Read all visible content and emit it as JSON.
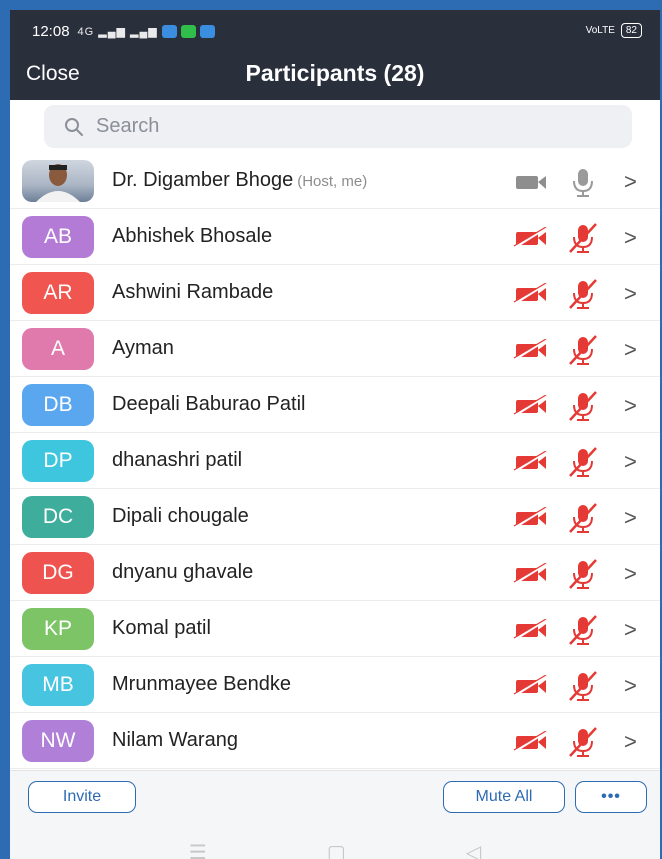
{
  "status_bar": {
    "time": "12:08",
    "signal_text": "4G",
    "network_label": "VoLTE",
    "battery": "82"
  },
  "header": {
    "close_label": "Close",
    "title": "Participants (28)"
  },
  "search": {
    "placeholder": "Search"
  },
  "participants": [
    {
      "initials": "",
      "name": "Dr. Digamber Bhoge",
      "role": "(Host, me)",
      "color": "#9aa6b5",
      "photo": true,
      "video": "on",
      "audio": "on"
    },
    {
      "initials": "AB",
      "name": "Abhishek Bhosale",
      "role": "",
      "color": "#b37ad6",
      "photo": false,
      "video": "off",
      "audio": "muted"
    },
    {
      "initials": "AR",
      "name": "Ashwini Rambade",
      "role": "",
      "color": "#f0564f",
      "photo": false,
      "video": "off",
      "audio": "muted"
    },
    {
      "initials": "A",
      "name": "Ayman",
      "role": "",
      "color": "#e07aac",
      "photo": false,
      "video": "off",
      "audio": "muted"
    },
    {
      "initials": "DB",
      "name": "Deepali Baburao Patil",
      "role": "",
      "color": "#5aa7f0",
      "photo": false,
      "video": "off",
      "audio": "muted"
    },
    {
      "initials": "DP",
      "name": "dhanashri patil",
      "role": "",
      "color": "#3ec6df",
      "photo": false,
      "video": "off",
      "audio": "muted"
    },
    {
      "initials": "DC",
      "name": "Dipali chougale",
      "role": "",
      "color": "#3fad9c",
      "photo": false,
      "video": "off",
      "audio": "muted"
    },
    {
      "initials": "DG",
      "name": "dnyanu ghavale",
      "role": "",
      "color": "#ef5350",
      "photo": false,
      "video": "off",
      "audio": "muted"
    },
    {
      "initials": "KP",
      "name": "Komal patil",
      "role": "",
      "color": "#7cc465",
      "photo": false,
      "video": "off",
      "audio": "muted"
    },
    {
      "initials": "MB",
      "name": "Mrunmayee Bendke",
      "role": "",
      "color": "#46c4e0",
      "photo": false,
      "video": "off",
      "audio": "muted"
    },
    {
      "initials": "NW",
      "name": "Nilam Warang",
      "role": "",
      "color": "#b07fd8",
      "photo": false,
      "video": "off",
      "audio": "muted"
    }
  ],
  "footer": {
    "invite_label": "Invite",
    "mute_all_label": "Mute All",
    "more_label": "•••"
  },
  "colors": {
    "header_bg": "#2a2f3c",
    "accent": "#2d6bb3",
    "muted_red": "#e53935"
  }
}
